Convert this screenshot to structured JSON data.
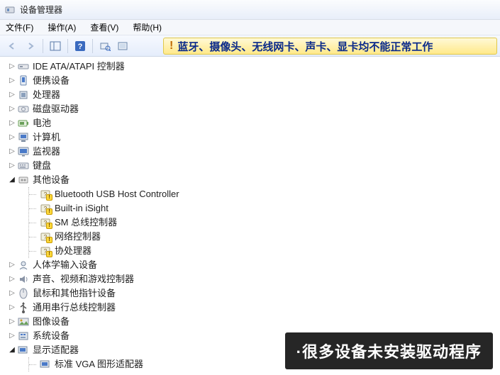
{
  "window": {
    "title": "设备管理器"
  },
  "menu": {
    "file": "文件(F)",
    "action": "操作(A)",
    "view": "查看(V)",
    "help": "帮助(H)"
  },
  "warning_banner": "蓝牙、摄像头、无线网卡、声卡、显卡均不能正常工作",
  "tree": {
    "items": [
      {
        "label": "IDE ATA/ATAPI 控制器",
        "icon": "ide"
      },
      {
        "label": "便携设备",
        "icon": "portable"
      },
      {
        "label": "处理器",
        "icon": "cpu"
      },
      {
        "label": "磁盘驱动器",
        "icon": "disk"
      },
      {
        "label": "电池",
        "icon": "battery"
      },
      {
        "label": "计算机",
        "icon": "computer"
      },
      {
        "label": "监视器",
        "icon": "monitor"
      },
      {
        "label": "键盘",
        "icon": "keyboard"
      }
    ],
    "other_devices": {
      "label": "其他设备",
      "children": [
        {
          "label": "Bluetooth USB Host Controller"
        },
        {
          "label": "Built-in iSight"
        },
        {
          "label": "SM 总线控制器"
        },
        {
          "label": "网络控制器"
        },
        {
          "label": "协处理器"
        }
      ]
    },
    "items2": [
      {
        "label": "人体学输入设备",
        "icon": "hid"
      },
      {
        "label": "声音、视频和游戏控制器",
        "icon": "sound"
      },
      {
        "label": "鼠标和其他指针设备",
        "icon": "mouse"
      },
      {
        "label": "通用串行总线控制器",
        "icon": "usb"
      },
      {
        "label": "图像设备",
        "icon": "image"
      },
      {
        "label": "系统设备",
        "icon": "system"
      }
    ],
    "display_adapters": {
      "label": "显示适配器",
      "child": {
        "label": "标准 VGA 图形适配器"
      }
    }
  },
  "overlay_caption": "·很多设备未安装驱动程序"
}
